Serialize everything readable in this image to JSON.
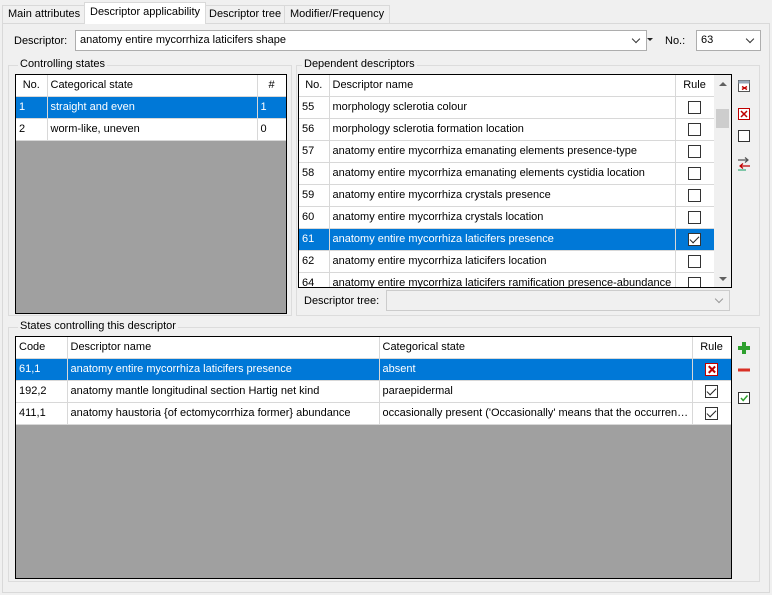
{
  "tabs": [
    {
      "label": "Main attributes"
    },
    {
      "label": "Descriptor applicability"
    },
    {
      "label": "Descriptor tree"
    },
    {
      "label": "Modifier/Frequency"
    }
  ],
  "descriptor": {
    "label": "Descriptor:",
    "value": "anatomy entire mycorrhiza laticifers shape",
    "no_label": "No.:",
    "no_value": "63"
  },
  "controlling_states": {
    "title": "Controlling states",
    "columns": {
      "no": "No.",
      "state": "Categorical state",
      "count": "#"
    },
    "rows": [
      {
        "no": "1",
        "state": "straight and even",
        "count": "1"
      },
      {
        "no": "2",
        "state": "worm-like, uneven",
        "count": "0"
      }
    ]
  },
  "dependent_descriptors": {
    "title": "Dependent descriptors",
    "columns": {
      "no": "No.",
      "name": "Descriptor name",
      "rule": "Rule"
    },
    "rows": [
      {
        "no": "55",
        "name": "morphology sclerotia colour",
        "rule": false
      },
      {
        "no": "56",
        "name": "morphology sclerotia formation location",
        "rule": false
      },
      {
        "no": "57",
        "name": "anatomy entire mycorrhiza emanating elements presence-type",
        "rule": false
      },
      {
        "no": "58",
        "name": "anatomy entire mycorrhiza emanating elements cystidia location",
        "rule": false
      },
      {
        "no": "59",
        "name": "anatomy entire mycorrhiza crystals presence",
        "rule": false
      },
      {
        "no": "60",
        "name": "anatomy entire mycorrhiza crystals location",
        "rule": false
      },
      {
        "no": "61",
        "name": "anatomy entire mycorrhiza laticifers presence",
        "rule": true
      },
      {
        "no": "62",
        "name": "anatomy entire mycorrhiza laticifers location",
        "rule": false
      },
      {
        "no": "64",
        "name": "anatomy entire mycorrhiza laticifers ramification presence-abundance",
        "rule": false
      }
    ],
    "tree_label": "Descriptor tree:",
    "tree_value": ""
  },
  "states_controlling": {
    "title": "States controlling this descriptor",
    "columns": {
      "code": "Code",
      "name": "Descriptor name",
      "state": "Categorical state",
      "rule": "Rule"
    },
    "rows": [
      {
        "code": "61,1",
        "name": "anatomy entire mycorrhiza laticifers presence",
        "state": "absent",
        "rule": "x"
      },
      {
        "code": "192,2",
        "name": "anatomy mantle longitudinal section Hartig net kind",
        "state": "paraepidermal",
        "rule": "on"
      },
      {
        "code": "411,1",
        "name": "anatomy haustoria {of ectomycorrhiza former} abundance",
        "state": "occasionally present ('Occasionally' means that the occurrence of the feature is uncertain)",
        "rule": "on"
      }
    ]
  },
  "colors": {
    "selection": "#0078d7",
    "add": "#2ea02e",
    "remove": "#d93025"
  },
  "icons": {
    "side1": "new-descriptor-icon",
    "side2": "delete-x-icon",
    "side3": "checkbox-icon",
    "side4": "swap-icon",
    "add": "plus-icon",
    "remove": "minus-icon",
    "check": "check-icon"
  }
}
